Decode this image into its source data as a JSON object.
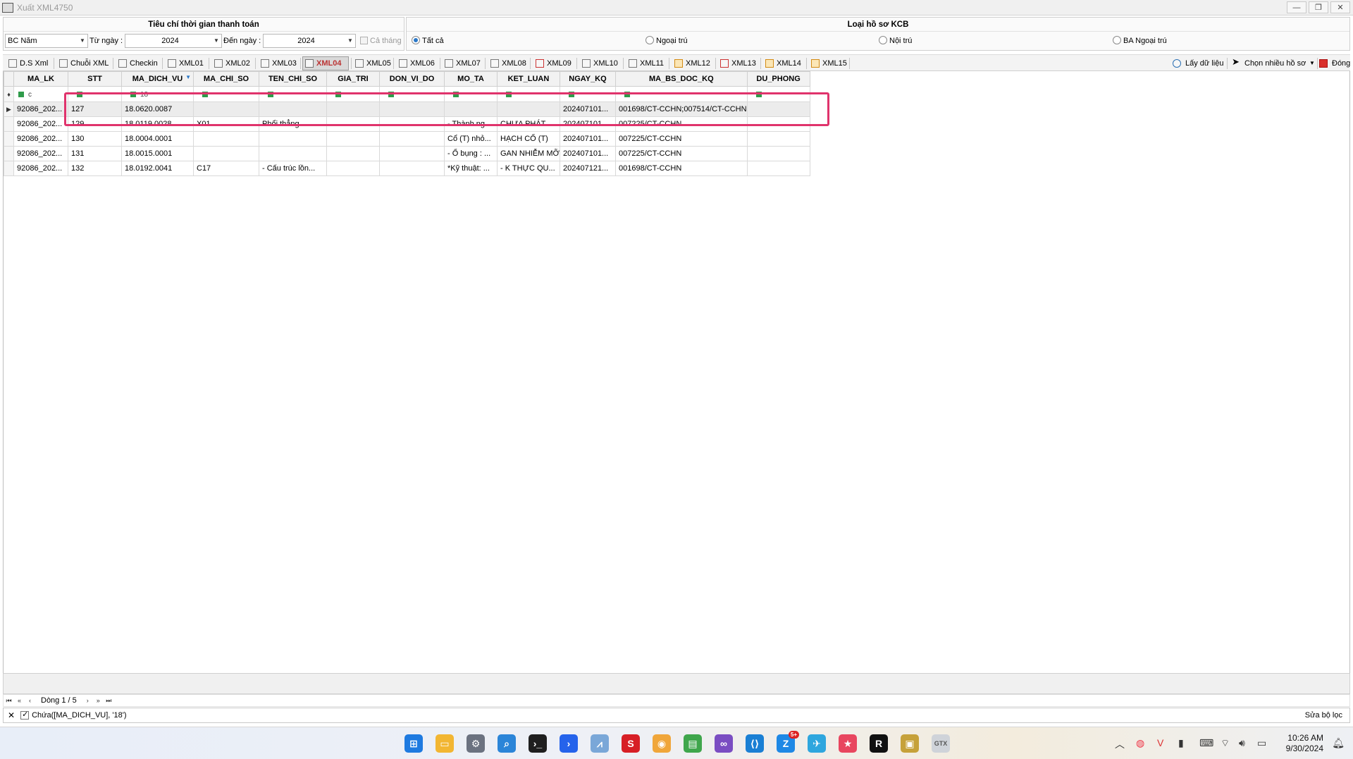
{
  "window": {
    "title": "Xuất XML4750",
    "controls": [
      "—",
      "❐",
      "✕"
    ]
  },
  "filters": {
    "header_left": "Tiêu chí thời gian thanh toán",
    "header_right": "Loại hồ sơ KCB",
    "report_type": "BC Năm",
    "from_label": "Từ ngày :",
    "from_value": "2024",
    "to_label": "Đến ngày :",
    "to_value": "2024",
    "whole_month_label": "Cả tháng",
    "radio_all": "Tất cả",
    "radio_outpatient": "Ngoại trú",
    "radio_inpatient": "Nội trú",
    "radio_ba_outpatient": "BA Ngoại trú",
    "selected_radio": "Tất cả"
  },
  "tabs": [
    {
      "label": "D.S Xml",
      "icon": "list-icon"
    },
    {
      "label": "Chuỗi XML",
      "icon": "code-icon"
    },
    {
      "label": "Checkin",
      "icon": "checkin-icon"
    },
    {
      "label": "XML01",
      "icon": "xml-icon"
    },
    {
      "label": "XML02",
      "icon": "xml-icon"
    },
    {
      "label": "XML03",
      "icon": "xml-icon"
    },
    {
      "label": "XML04",
      "icon": "table-icon"
    },
    {
      "label": "XML05",
      "icon": "table-icon"
    },
    {
      "label": "XML06",
      "icon": "xml-icon"
    },
    {
      "label": "XML07",
      "icon": "xml-icon"
    },
    {
      "label": "XML08",
      "icon": "xml-icon"
    },
    {
      "label": "XML09",
      "icon": "xml-red-icon"
    },
    {
      "label": "XML10",
      "icon": "xml-icon"
    },
    {
      "label": "XML11",
      "icon": "xml-icon"
    },
    {
      "label": "XML12",
      "icon": "xml-orange-icon"
    },
    {
      "label": "XML13",
      "icon": "xml-red-icon"
    },
    {
      "label": "XML14",
      "icon": "xml-orange-icon"
    },
    {
      "label": "XML15",
      "icon": "xml-orange-icon"
    }
  ],
  "active_tab": "XML04",
  "actions": {
    "fetch": "Lấy dữ liệu",
    "multi_select": "Chọn nhiều hồ sơ",
    "close": "Đóng"
  },
  "grid": {
    "columns": [
      "MA_LK",
      "STT",
      "MA_DICH_VU",
      "MA_CHI_SO",
      "TEN_CHI_SO",
      "GIA_TRI",
      "DON_VI_DO",
      "MO_TA",
      "KET_LUAN",
      "NGAY_KQ",
      "MA_BS_DOC_KQ",
      "DU_PHONG"
    ],
    "filter_row": {
      "MA_LK": "c",
      "MA_DICH_VU": "18"
    },
    "rows": [
      [
        "92086_202...",
        "127",
        "18.0620.0087",
        "",
        "",
        "",
        "",
        "",
        "",
        "202407101...",
        "001698/CT-CCHN;007514/CT-CCHN",
        ""
      ],
      [
        "92086_202...",
        "129",
        "18.0119.0028",
        "X01",
        "Phổi thẳng",
        "",
        "",
        "- Thành ng...",
        "CHƯA PHÁT ...",
        "202407101...",
        "007225/CT-CCHN",
        ""
      ],
      [
        "92086_202...",
        "130",
        "18.0004.0001",
        "",
        "",
        "",
        "",
        "Cổ (T) nhỏ...",
        "HẠCH CỔ (T)",
        "202407101...",
        "007225/CT-CCHN",
        ""
      ],
      [
        "92086_202...",
        "131",
        "18.0015.0001",
        "",
        "",
        "",
        "",
        "- Ổ bụng : ...",
        "GAN NHIỄM MỠ",
        "202407101...",
        "007225/CT-CCHN",
        ""
      ],
      [
        "92086_202...",
        "132",
        "18.0192.0041",
        "C17",
        "-   Cấu trúc lồn...",
        "",
        "",
        "*Kỹ thuật: ...",
        "- K THỰC QU...",
        "202407121...",
        "001698/CT-CCHN",
        ""
      ]
    ]
  },
  "navigator": {
    "label": "Dòng 1 / 5"
  },
  "filter_bar": {
    "expression": "Chứa([MA_DICH_VU], '18')",
    "edit_label": "Sửa bộ lọc"
  },
  "taskbar": {
    "time": "10:26 AM",
    "date": "9/30/2024",
    "zalo_badge": "5+"
  }
}
